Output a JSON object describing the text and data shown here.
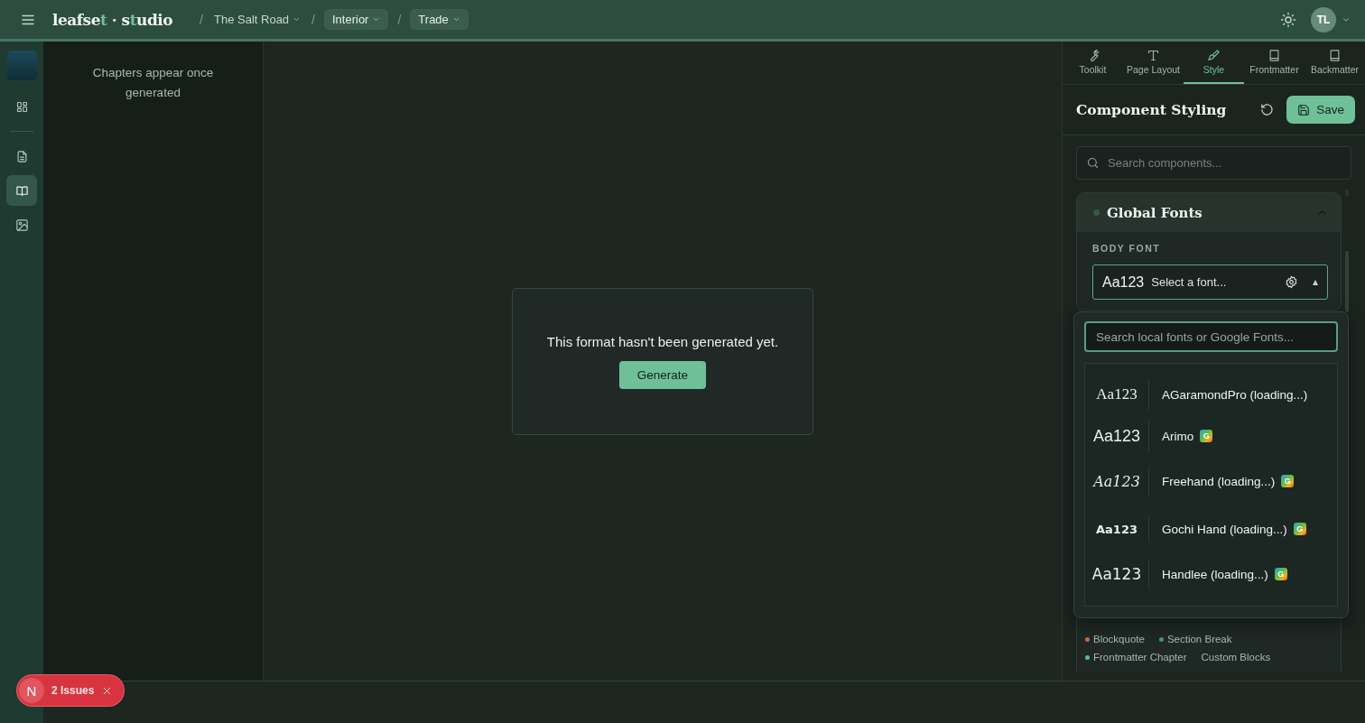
{
  "header": {
    "brand": [
      {
        "text": "leafse",
        "accent": false
      },
      {
        "text": "t",
        "accent": true
      },
      {
        "text": " · s",
        "accent": false
      },
      {
        "text": "t",
        "accent": true
      },
      {
        "text": "udio",
        "accent": false
      }
    ],
    "separator": "/",
    "breadcrumbs": [
      {
        "label": "The Salt Road",
        "boxed": false
      },
      {
        "label": "Interior",
        "boxed": true
      },
      {
        "label": "Trade",
        "boxed": true
      }
    ],
    "avatar": "TL"
  },
  "rail": [
    {
      "kind": "grid",
      "selected": false
    },
    {
      "kind": "document",
      "selected": false
    },
    {
      "kind": "book",
      "selected": true
    },
    {
      "kind": "image",
      "selected": false
    }
  ],
  "chapters": {
    "empty_text": "Chapters appear once generated"
  },
  "preview": {
    "message": "This format hasn't been generated yet.",
    "button": "Generate"
  },
  "tabs": [
    {
      "label": "Toolkit",
      "kind": "wrench",
      "selected": false
    },
    {
      "label": "Page Layout",
      "kind": "type",
      "selected": false
    },
    {
      "label": "Style",
      "kind": "brush",
      "selected": true
    },
    {
      "label": "Frontmatter",
      "kind": "book",
      "selected": false
    },
    {
      "label": "Backmatter",
      "kind": "book",
      "selected": false
    }
  ],
  "panel": {
    "title": "Component Styling",
    "save": "Save",
    "search_placeholder": "Search components...",
    "section": {
      "title": "Global Fonts",
      "expanded": true,
      "field_label": "BODY FONT",
      "preview": "Aa123",
      "placeholder": "Select a font...",
      "open": true
    },
    "tags": [
      {
        "label": "Blockquote",
        "color": "#c46a44"
      },
      {
        "label": "Section Break",
        "color": "#3d9b77"
      },
      {
        "label": "Frontmatter Chapter",
        "color": "#62b894"
      },
      {
        "label": "Custom Blocks"
      }
    ]
  },
  "font_menu": {
    "placeholder": "Search local fonts or Google Fonts...",
    "fonts": [
      {
        "preview": "Aa123",
        "kind": "serif",
        "name": "AGaramondPro (loading...)"
      },
      {
        "preview": "Aa123",
        "kind": "sans",
        "name": "Arimo",
        "badge": "G"
      },
      {
        "preview": "Aa123",
        "kind": "script",
        "name": "Freehand (loading...)",
        "badge": "G"
      },
      {
        "preview": "Aa123",
        "kind": "bold-hand",
        "name": "Gochi Hand (loading...)",
        "badge": "G"
      },
      {
        "preview": "Aa123",
        "kind": "hand",
        "name": "Handlee (loading...)",
        "badge": "G"
      }
    ]
  },
  "issues": {
    "initial": "N",
    "label": "2 Issues"
  }
}
